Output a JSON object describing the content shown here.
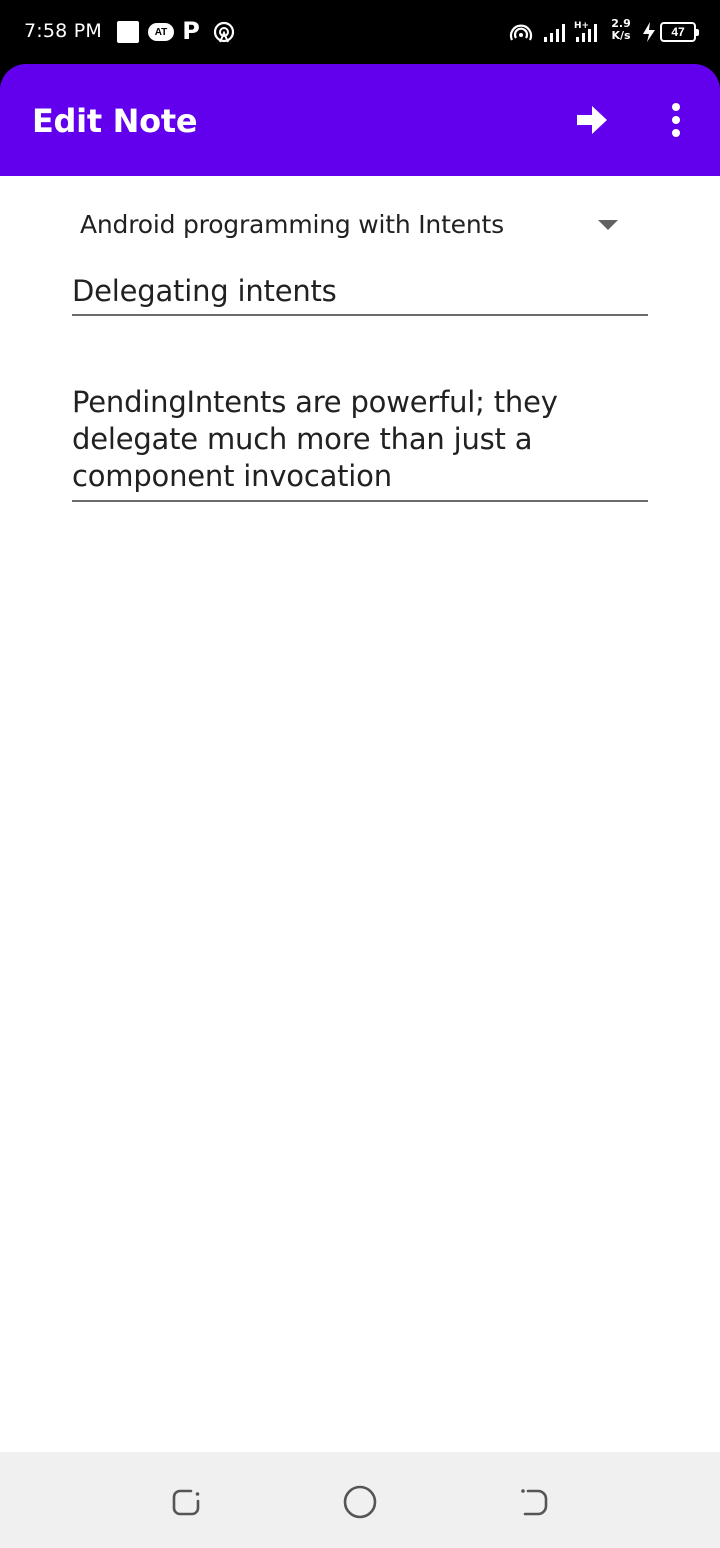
{
  "status_bar": {
    "time": "7:58 PM",
    "badge_text": "AT",
    "p_icon": "P",
    "speed_value": "2.9",
    "speed_unit": "K/s",
    "battery": "47",
    "icons": [
      "gallery-icon",
      "app-badge-icon",
      "p-app-icon",
      "hotspot-icon",
      "wifi-hotspot-icon",
      "signal-icon",
      "signal-h-plus-icon",
      "charging-icon",
      "battery-icon"
    ]
  },
  "app_bar": {
    "title": "Edit Note",
    "actions": [
      "next-arrow-icon",
      "more-vert-icon"
    ]
  },
  "note": {
    "course": "Android programming with Intents",
    "title": "Delegating intents",
    "text": "PendingIntents are powerful; they delegate much more than just a component invocation"
  },
  "nav_bar": {
    "buttons": [
      "recents",
      "home",
      "back"
    ]
  },
  "colors": {
    "primary": "#6200EE",
    "on_primary": "#FFFFFF",
    "text": "#212121",
    "underline": "#6B6B6B",
    "nav_bg": "#F0F0F0"
  }
}
